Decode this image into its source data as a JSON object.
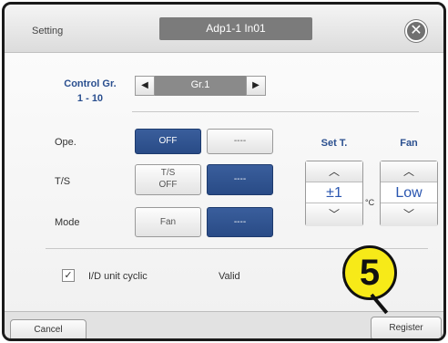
{
  "header": {
    "setting_label": "Setting",
    "unit_title": "Adp1-1 In01",
    "close_symbol": "✕"
  },
  "control_group": {
    "label_line1": "Control Gr.",
    "label_line2": "1 - 10",
    "prev_symbol": "◀",
    "next_symbol": "▶",
    "value": "Gr.1"
  },
  "ope": {
    "label": "Ope.",
    "off_label": "OFF",
    "dash_label": "----",
    "selected": "OFF"
  },
  "ts": {
    "label": "T/S",
    "option_line1": "T/S",
    "option_line2": "OFF",
    "dash_label": "----",
    "selected": "----"
  },
  "mode": {
    "label": "Mode",
    "fan_label": "Fan",
    "dash_label": "----",
    "selected": "----"
  },
  "set_temp": {
    "label": "Set T.",
    "up_symbol": "︿",
    "down_symbol": "﹀",
    "value": "±1",
    "unit": "°C"
  },
  "fan": {
    "label": "Fan",
    "up_symbol": "︿",
    "down_symbol": "﹀",
    "value": "Low"
  },
  "cyclic": {
    "checkbox_mark": "✓",
    "checked": true,
    "label": "I/D unit cyclic",
    "status": "Valid"
  },
  "footer": {
    "cancel_label": "Cancel",
    "register_label": "Register"
  },
  "annotation": {
    "step_number": "5"
  },
  "colors": {
    "selected_blue": "#2c4f8a",
    "badge_yellow": "#f7ea18",
    "value_blue": "#2a56b0"
  }
}
